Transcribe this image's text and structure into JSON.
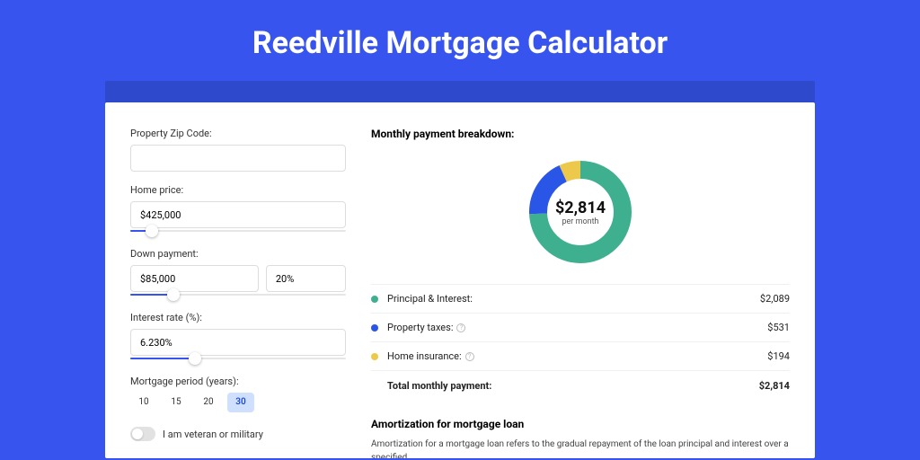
{
  "title": "Reedville Mortgage Calculator",
  "form": {
    "zip": {
      "label": "Property Zip Code:",
      "value": ""
    },
    "price": {
      "label": "Home price:",
      "value": "$425,000",
      "slider_pct": 10
    },
    "down": {
      "label": "Down payment:",
      "value": "$85,000",
      "pct_value": "20%",
      "slider_pct": 20
    },
    "rate": {
      "label": "Interest rate (%):",
      "value": "6.230%",
      "slider_pct": 30
    },
    "period": {
      "label": "Mortgage period (years):",
      "options": [
        "10",
        "15",
        "20",
        "30"
      ],
      "selected": "30"
    },
    "veteran": {
      "label": "I am veteran or military",
      "on": false
    }
  },
  "breakdown": {
    "title": "Monthly payment breakdown:",
    "center_amount": "$2,814",
    "center_sub": "per month",
    "rows": [
      {
        "color": "#3fb08f",
        "label": "Principal & Interest:",
        "value": "$2,089",
        "help": false
      },
      {
        "color": "#2a56e8",
        "label": "Property taxes:",
        "value": "$531",
        "help": true
      },
      {
        "color": "#ecc94b",
        "label": "Home insurance:",
        "value": "$194",
        "help": true
      }
    ],
    "total": {
      "label": "Total monthly payment:",
      "value": "$2,814"
    }
  },
  "chart_data": {
    "type": "pie",
    "title": "Monthly payment breakdown",
    "series": [
      {
        "name": "Principal & Interest",
        "value": 2089,
        "color": "#3fb08f"
      },
      {
        "name": "Property taxes",
        "value": 531,
        "color": "#2a56e8"
      },
      {
        "name": "Home insurance",
        "value": 194,
        "color": "#ecc94b"
      }
    ],
    "total": 2814,
    "center_label": "$2,814 per month"
  },
  "amortization": {
    "title": "Amortization for mortgage loan",
    "body": "Amortization for a mortgage loan refers to the gradual repayment of the loan principal and interest over a specified"
  }
}
